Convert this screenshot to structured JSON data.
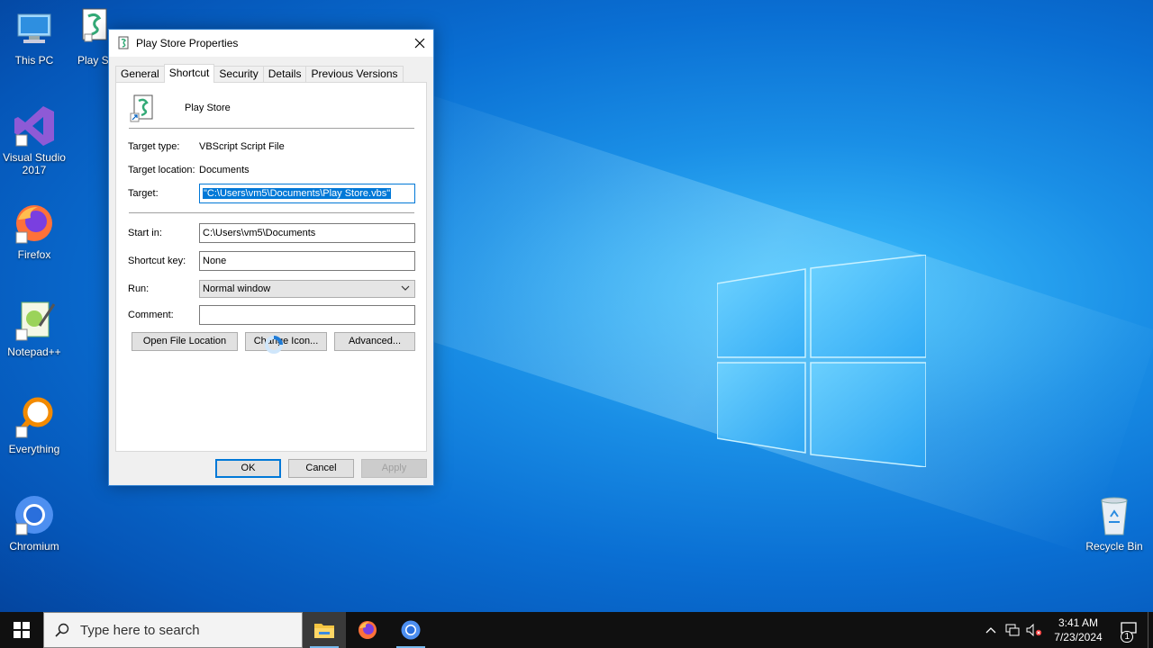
{
  "desktop": {
    "icons": [
      {
        "label": "This PC"
      },
      {
        "label": "Play St"
      },
      {
        "label": "Visual Studio 2017"
      },
      {
        "label": "Firefox"
      },
      {
        "label": "Notepad++"
      },
      {
        "label": "Everything"
      },
      {
        "label": "Chromium"
      },
      {
        "label": "Recycle Bin"
      }
    ]
  },
  "dialog": {
    "title": "Play Store Properties",
    "tabs": [
      {
        "label": "General"
      },
      {
        "label": "Shortcut"
      },
      {
        "label": "Security"
      },
      {
        "label": "Details"
      },
      {
        "label": "Previous Versions"
      }
    ],
    "active_tab": "Shortcut",
    "file_name": "Play Store",
    "target_type_label": "Target type:",
    "target_type_value": "VBScript Script File",
    "target_location_label": "Target location:",
    "target_location_value": "Documents",
    "target_label": "Target:",
    "target_value": "\"C:\\Users\\vm5\\Documents\\Play Store.vbs\"",
    "start_in_label": "Start in:",
    "start_in_value": "C:\\Users\\vm5\\Documents",
    "shortcut_key_label": "Shortcut key:",
    "shortcut_key_value": "None",
    "run_label": "Run:",
    "run_value": "Normal window",
    "comment_label": "Comment:",
    "comment_value": "",
    "open_file_location": "Open File Location",
    "change_icon": "Change Icon...",
    "advanced": "Advanced...",
    "ok": "OK",
    "cancel": "Cancel",
    "apply": "Apply"
  },
  "taskbar": {
    "search_placeholder": "Type here to search",
    "time": "3:41 AM",
    "date": "7/23/2024",
    "notification_count": "1"
  },
  "colors": {
    "accent": "#0078d7",
    "taskbar": "#101010"
  }
}
